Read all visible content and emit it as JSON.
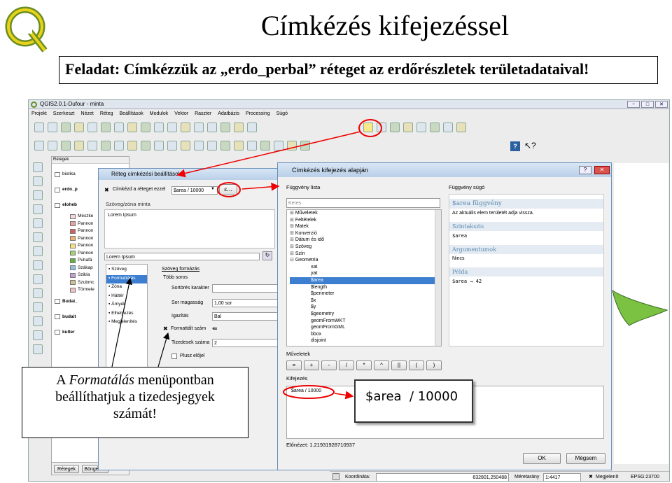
{
  "slide": {
    "title": "Címkézés kifejezéssel",
    "task": "Feladat: Címkézzük az „erdo_perbal” réteget az erdőrészletek területadataival!",
    "callout": "A Formatálás menüpontban beállíthatjuk a tizedesjegyek számát!",
    "callout_lines": [
      "A ",
      "Formatálás",
      " menüpontban",
      "beállíthatjuk a tizedesjegyek",
      "számát!"
    ]
  },
  "qgis": {
    "window_title": "QGIS2.0.1-Dufour - minta",
    "menu": [
      "Projekt",
      "Szerkeszt",
      "Nézet",
      "Réteg",
      "Beállítások",
      "Modulok",
      "Vektor",
      "Raszter",
      "Adatbázis",
      "Processing",
      "Súgó"
    ],
    "layers_panel_title": "Rétegek",
    "layers": [
      "biotika",
      "erdo_p",
      "eloheb",
      "Mészke",
      "Pannon",
      "Pannon",
      "Pannon",
      "Pannon",
      "Pannon",
      "Puhafá",
      "Szákap",
      "Szikla",
      "Szubmc",
      "Törmele",
      "Budai_",
      "budait",
      "kulter"
    ],
    "layer_colors": [
      "#f4d8d8",
      "#e8a0a0",
      "#d06060",
      "#f0b070",
      "#f8e080",
      "#a0d070",
      "#60b040",
      "#90c0e0",
      "#c0a0d0",
      "#d0c090",
      "#f0c0c0",
      "#c0d0f0",
      "#e0e0a0"
    ],
    "tabs": [
      "Rétegek",
      "Böngésző"
    ],
    "status": {
      "coord_label": "Koordináta:",
      "coord_value": "632801,250488",
      "scale_label": "Méretarány",
      "scale_value": "1:4417",
      "render_label": "Megjelenít",
      "crs": "EPSG:23700"
    },
    "help_icon": "?"
  },
  "label_dialog": {
    "title": "Réteg címkézési beállítások",
    "checkbox_label": "Címkézd a réteget ezzel",
    "expression": "$area / 10000",
    "epsilon": "ε...",
    "section": "Szöveg/zóna minta",
    "preview": "Lorem Ipsum",
    "preview_field": "Lorem Ipsum",
    "categories": [
      "Szöveg",
      "Formattálás",
      "Zóna",
      "Háttér",
      "Árnyék",
      "Elhelyezés",
      "Megjelenítés"
    ],
    "format_title": "Szöveg formázás",
    "multiline": "Több soros",
    "wrap_char": "Sortörés karakter",
    "line_height_label": "Sor magasság",
    "line_height_value": "1,00 sor",
    "align_label": "Igazítás",
    "align_value": "Bal",
    "formatted_number": "Formattált szám",
    "decimals_label": "Tizedesek száma",
    "decimals_value": "2",
    "plus_sign": "Plusz előjel"
  },
  "expr_dialog": {
    "title": "Címkézés kifejezés alapján",
    "func_list_label": "Függvény lista",
    "search_placeholder": "Keres",
    "tree": [
      "Műveletek",
      "Feltételek",
      "Matek",
      "Konverzió",
      "Dátum és idő",
      "Szöveg",
      "Szín",
      "Geometria",
      "xat",
      "yat",
      "$area",
      "$length",
      "$perimeter",
      "$x",
      "$y",
      "$geometry",
      "geomFromWKT",
      "geomFromGML",
      "bbox",
      "disjoint"
    ],
    "help_label": "Függvény súgó",
    "help_title": "$area függvény",
    "help_desc": "Az aktuális elem területét adja vissza.",
    "syntax_head": "Szintakszis",
    "syntax": "$area",
    "args_head": "Argumentumok",
    "args": "Nincs",
    "example_head": "Példa",
    "example": "$area → 42",
    "operators_label": "Műveletek",
    "operators": [
      "=",
      "+",
      "-",
      "/",
      "*",
      "^",
      "||",
      "(",
      ")"
    ],
    "expression_label": "Kifejezés",
    "expression": "$area / 10000",
    "zoom_expression": "$area  / 10000",
    "preview": "Előnézet: 1.21931928710937",
    "ok": "OK",
    "cancel": "Mégsem"
  }
}
